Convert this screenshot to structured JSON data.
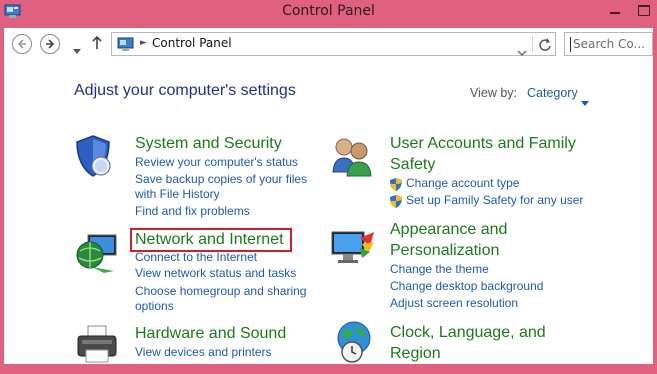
{
  "window": {
    "title": "Control Panel"
  },
  "address": {
    "path": "Control Panel"
  },
  "search": {
    "placeholder": "Search Co..."
  },
  "main": {
    "heading": "Adjust your computer's settings",
    "view_by_label": "View by:",
    "view_by_value": "Category"
  },
  "categories": [
    {
      "title": "System and Security",
      "links": [
        "Review your computer's status",
        "Save backup copies of your files",
        "with File History",
        "Find and fix problems"
      ]
    },
    {
      "title": "Network and Internet",
      "links": [
        "Connect to the Internet",
        "View network status and tasks",
        "Choose homegroup and sharing",
        "options"
      ]
    },
    {
      "title": "Hardware and Sound",
      "links": [
        "View devices and printers"
      ]
    },
    {
      "title_line1": "User Accounts and Family",
      "title_line2": "Safety",
      "links": [
        "Change account type",
        "Set up Family Safety for any user"
      ]
    },
    {
      "title_line1": "Appearance and",
      "title_line2": "Personalization",
      "links": [
        "Change the theme",
        "Change desktop background",
        "Adjust screen resolution"
      ]
    },
    {
      "title_line1": "Clock, Language, and",
      "title_line2": "Region",
      "links": []
    }
  ],
  "colors": {
    "frame": "#e0607f",
    "category_title": "#1a7a1a",
    "link": "#1e5aa8",
    "heading": "#1e3287",
    "highlight": "#d0202a"
  },
  "icons": [
    "control-panel-icon",
    "back-arrow-icon",
    "forward-arrow-icon",
    "up-arrow-icon",
    "refresh-icon",
    "security-shield-icon",
    "network-globe-icon",
    "printer-icon",
    "users-icon",
    "monitor-paint-icon",
    "globe-clock-icon",
    "uac-shield-icon"
  ]
}
